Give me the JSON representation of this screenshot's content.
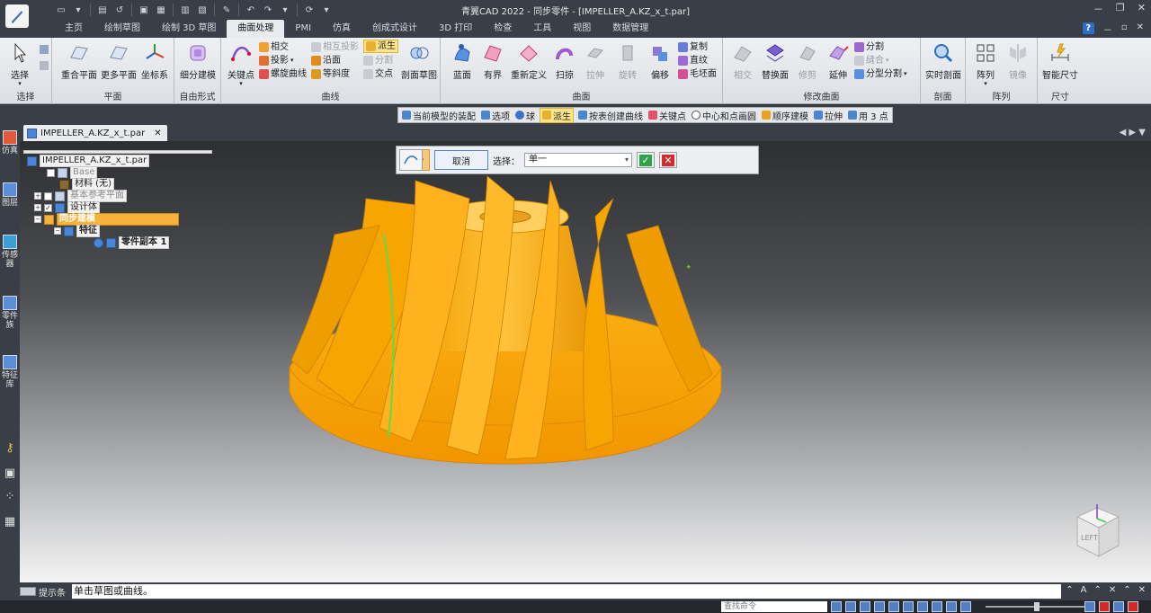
{
  "window": {
    "title": "青翼CAD 2022 - 同步零件 - [IMPELLER_A.KZ_x_t.par]",
    "controls": [
      "－",
      "❐",
      "✕"
    ]
  },
  "ribbon_tabs": [
    {
      "label": "主页"
    },
    {
      "label": "绘制草图"
    },
    {
      "label": "绘制 3D 草图"
    },
    {
      "label": "曲面处理",
      "active": true
    },
    {
      "label": "PMI"
    },
    {
      "label": "仿真"
    },
    {
      "label": "创成式设计"
    },
    {
      "label": "3D 打印"
    },
    {
      "label": "检查"
    },
    {
      "label": "工具"
    },
    {
      "label": "视图"
    },
    {
      "label": "数据管理"
    }
  ],
  "tab_right": {
    "help": "?",
    "min": "－",
    "restore": "▫",
    "close": "✕"
  },
  "ribbon": {
    "select_group": {
      "label": "选择",
      "select_btn": "选择"
    },
    "plane_group": {
      "label": "平面",
      "coincident": "重合平面",
      "more_planes": "更多平面",
      "coord": "坐标系"
    },
    "freeform_group": {
      "label": "自由形式",
      "subdivision": "细分建模"
    },
    "curve_group": {
      "label": "曲线",
      "keypoint": "关键点",
      "intersect": "相交",
      "project": "投影",
      "helix": "螺旋曲线",
      "intersect_project": "相互投影",
      "along_surface": "沿面",
      "isocline": "等斜度",
      "derive": "派生",
      "split": "分割",
      "cross": "交点",
      "section_sketch": "剖面草图"
    },
    "surface_group": {
      "label": "曲面",
      "bluesurf": "蓝面",
      "bounded": "有界",
      "redefine": "重新定义",
      "sweep": "扫掠",
      "extrude": "拉伸",
      "revolve": "旋转",
      "offset": "偏移",
      "copy": "复制",
      "ruled": "直纹",
      "rough": "毛坯面"
    },
    "modify_group": {
      "label": "修改曲面",
      "intersect": "相交",
      "replace": "替换面",
      "trim": "修剪",
      "extend": "延伸",
      "split": "分割",
      "stitch": "缝合",
      "parting": "分型分割"
    },
    "section_group": {
      "label": "剖面",
      "live": "实时剖面"
    },
    "array_group": {
      "label": "阵列",
      "array": "阵列",
      "mirror": "镜像"
    },
    "dim_group": {
      "label": "尺寸",
      "smart": "智能尺寸"
    }
  },
  "cmdbar": [
    {
      "label": "当前模型的装配",
      "color": "#4a86d4"
    },
    {
      "label": "选项",
      "color": "#4a86d4"
    },
    {
      "label": "球",
      "color": "#3a74c8"
    },
    {
      "label": "派生",
      "color": "#e8b030",
      "hl": true
    },
    {
      "label": "按表创建曲线",
      "color": "#4a86d4"
    },
    {
      "label": "关键点",
      "color": "#e6506a"
    },
    {
      "label": "中心和点画圆",
      "color": "#ffffff"
    },
    {
      "label": "顺序建模",
      "color": "#f0a020"
    },
    {
      "label": "拉伸",
      "color": "#4a86d4"
    },
    {
      "label": "用 3 点",
      "color": "#4a86d4"
    }
  ],
  "leftdock": [
    {
      "label": "仿真"
    },
    {
      "label": "图层"
    },
    {
      "label": "传感器"
    },
    {
      "label": "零件族"
    },
    {
      "label": "特征库"
    }
  ],
  "document": {
    "tab": "IMPELLER_A.KZ_x_t.par",
    "close": "✕",
    "nav": "◀ ▶ ▼"
  },
  "tree": {
    "root": "IMPELLER_A.KZ_x_t.par",
    "base": "Base",
    "material": "材料 (无)",
    "ref_planes": "基本参考平面",
    "design_body": "设计体",
    "sync_model": "同步建模",
    "features": "特征",
    "part_copy": "零件副本 1"
  },
  "floatbar": {
    "cancel": "取消",
    "select_label": "选择：",
    "select_value": "单一",
    "ok": "✓",
    "x": "✕"
  },
  "viewcube_label": "LEFT",
  "status": {
    "prompt_label": "提示条",
    "prompt_text": "单击草图或曲线。",
    "right": [
      "⌃",
      "A",
      "⌃",
      "✕",
      "⌃",
      "✕"
    ]
  },
  "bottombar": {
    "find_placeholder": "查找命令"
  },
  "colors": {
    "accent": "#f5a623",
    "chrome": "#3a3f47",
    "edge_highlight": "#5fdc4a"
  }
}
